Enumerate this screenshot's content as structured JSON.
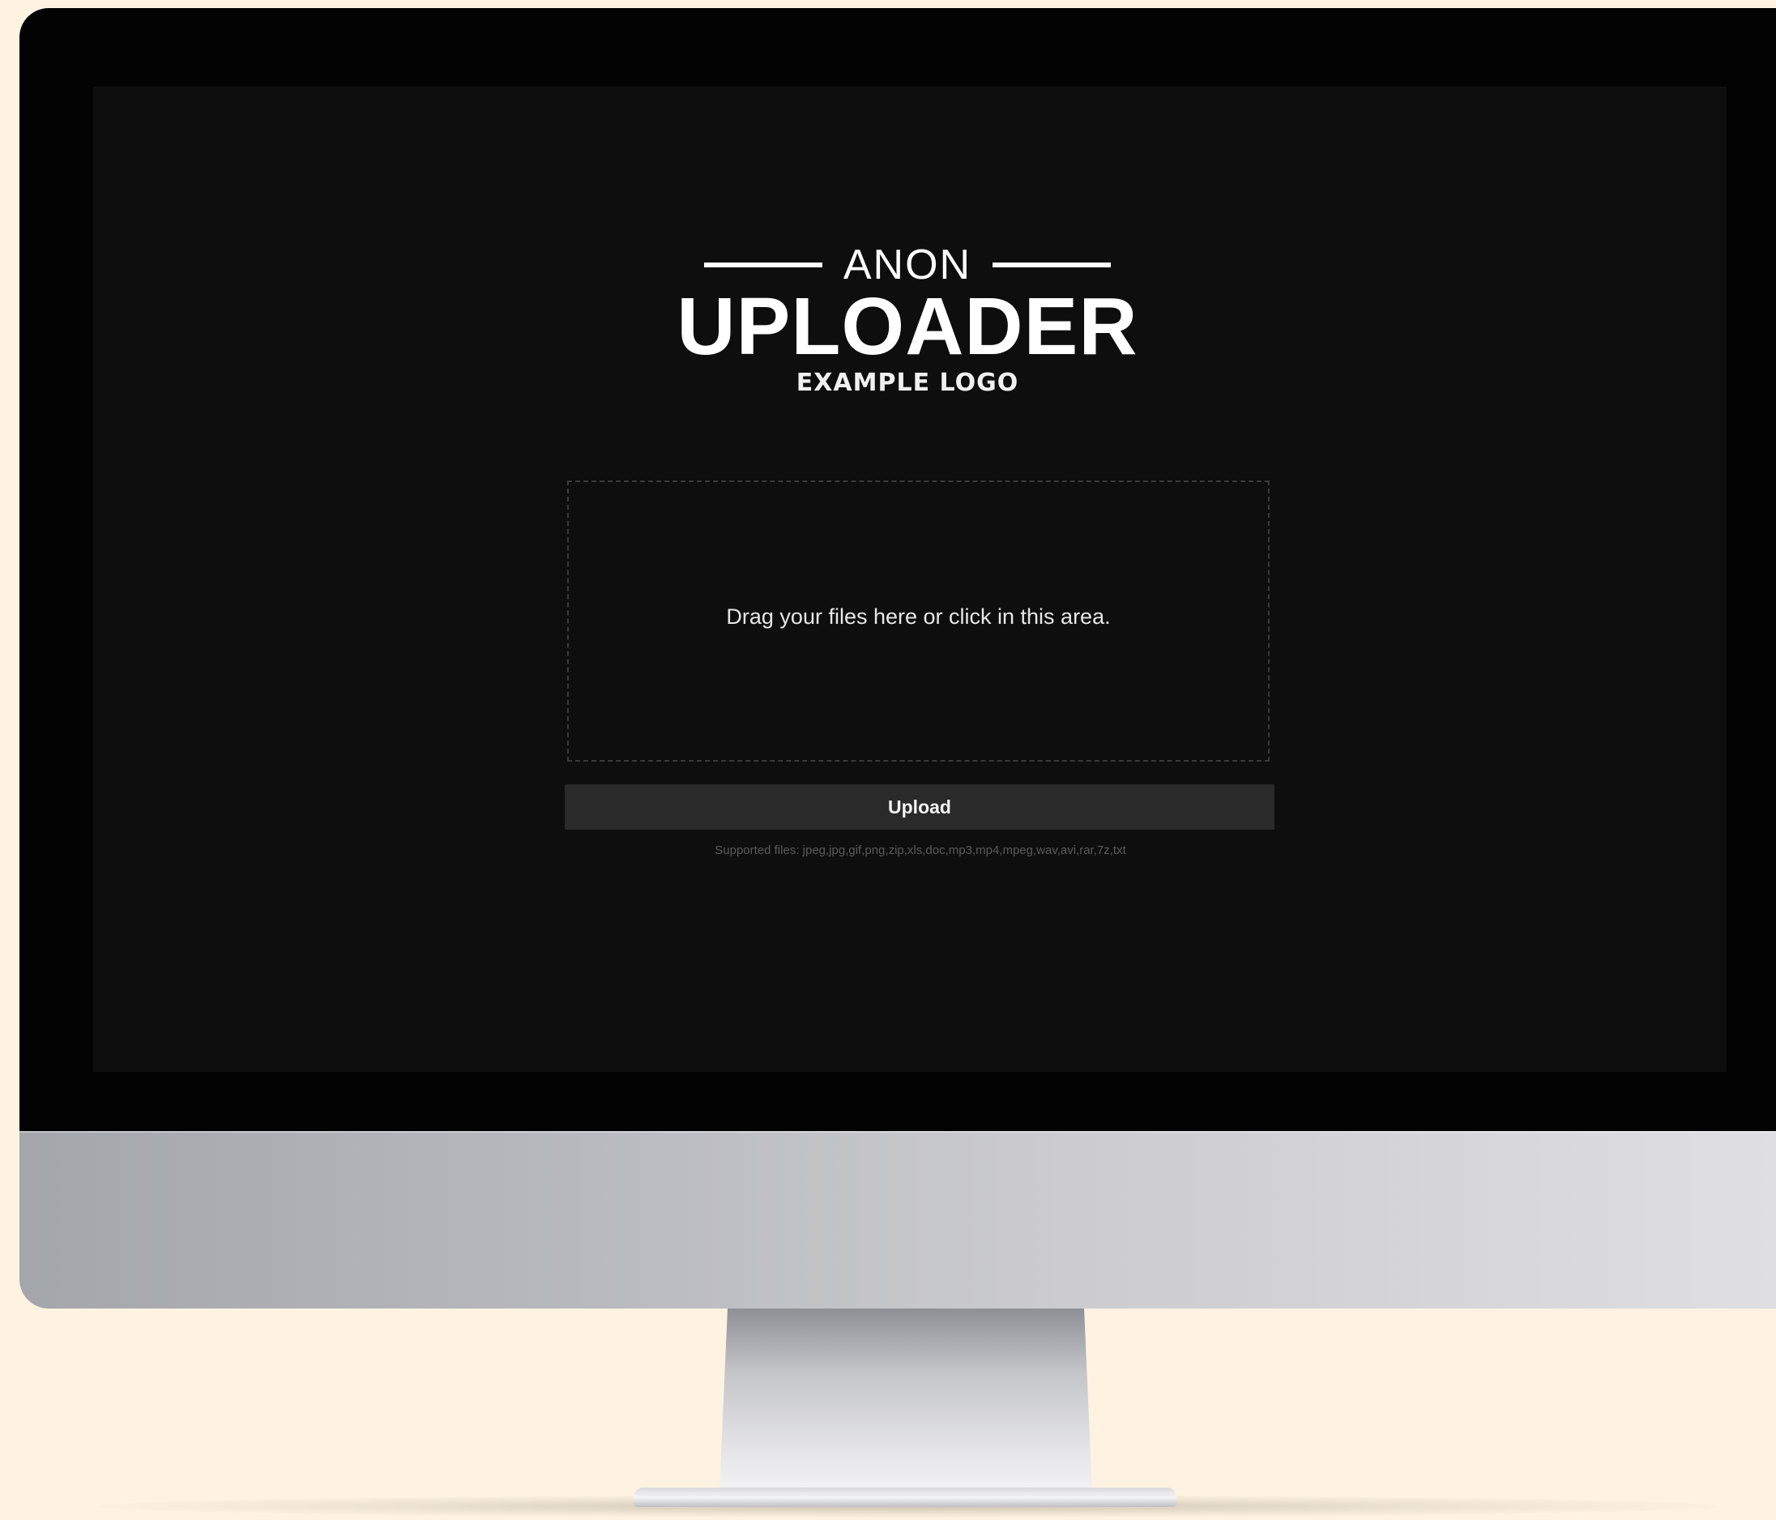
{
  "logo": {
    "top_word": "ANON",
    "main_word": "UPLOADER",
    "sub_word": "EXAMPLE LOGO"
  },
  "dropzone": {
    "text": "Drag your files here or click in this area."
  },
  "upload_button": {
    "label": "Upload"
  },
  "supported_files": {
    "text": "Supported files: jpeg,jpg,gif,png,zip,xls,doc,mp3,mp4,mpeg,wav,avi,rar,7z,txt"
  },
  "colors": {
    "page_background": "#fdf3e0",
    "screen_background": "#0e0e0e",
    "bezel": "#030303",
    "button_background": "#2a2a2a",
    "text_primary": "#ffffff"
  }
}
